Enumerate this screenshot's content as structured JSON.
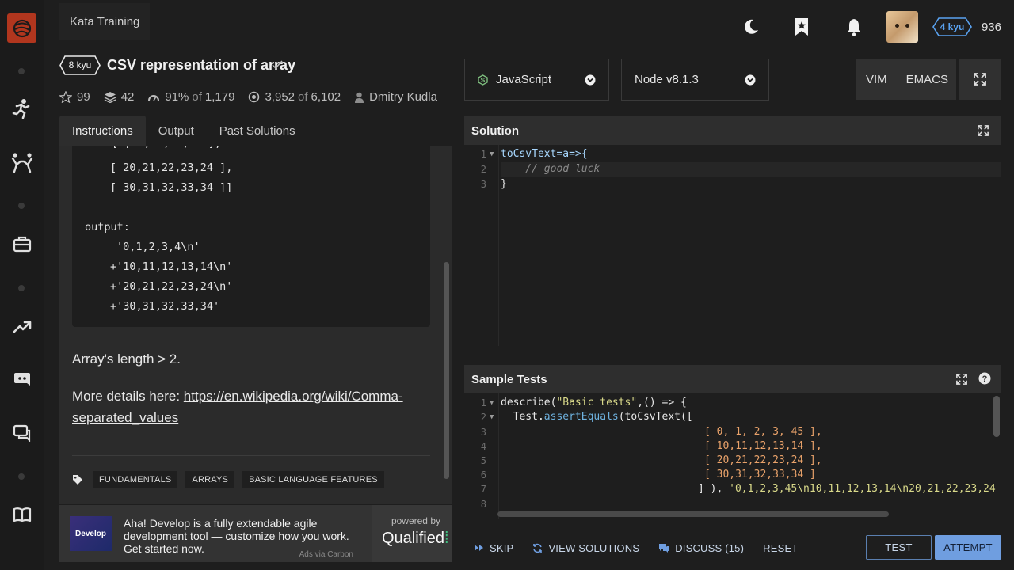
{
  "header": {
    "section_title": "Kata Training",
    "rank": "4 kyu",
    "honor": "936"
  },
  "kata": {
    "kyu": "8 kyu",
    "title": "CSV representation of array",
    "stats": {
      "stars": "99",
      "collections": "42",
      "satisfaction_pct": "91%",
      "satisfaction_of": "of",
      "satisfaction_total": "1,179",
      "completed": "3,952",
      "completed_of": "of",
      "completed_total": "6,102",
      "author": "Dmitry Kudla"
    }
  },
  "tabs": [
    {
      "label": "Instructions"
    },
    {
      "label": "Output"
    },
    {
      "label": "Past Solutions"
    }
  ],
  "instructions": {
    "code_lines": [
      "[ 20,21,22,23,24 ],",
      "[ 30,31,32,33,34 ]]",
      "output:",
      "'0,1,2,3,4\\n'",
      "+'10,11,12,13,14\\n'",
      "+'20,21,22,23,24\\n'",
      "+'30,31,32,33,34'"
    ],
    "para1": "Array's length > 2.",
    "para2_prefix": "More details here: ",
    "para2_link_line1": "https://en.wikipedia.org/wiki/Comma-",
    "para2_link_line2": "separated_values",
    "tags": [
      "FUNDAMENTALS",
      "ARRAYS",
      "BASIC LANGUAGE FEATURES"
    ]
  },
  "ad": {
    "logo_text": "Develop",
    "text": "Aha! Develop is a fully extendable agile development tool — customize how you work. Get started now.",
    "via": "Ads via Carbon",
    "powered_by": "powered by",
    "brand": "Qualified"
  },
  "editor": {
    "language": "JavaScript",
    "runtime": "Node v8.1.3",
    "modes": [
      "VIM",
      "EMACS"
    ],
    "solution_title": "Solution",
    "solution_lines": [
      {
        "n": "1",
        "text": "toCsvText=a=>{"
      },
      {
        "n": "2",
        "text": "    // good luck"
      },
      {
        "n": "3",
        "text": "}"
      }
    ],
    "tests_title": "Sample Tests",
    "test_line_numbers": [
      "1",
      "2",
      "3",
      "4",
      "5",
      "6",
      "7",
      "8"
    ],
    "test_lines": {
      "l1_a": "describe(",
      "l1_str": "\"Basic tests\"",
      "l1_b": ",() => {",
      "l2_a": "  Test.",
      "l2_method": "assertEquals",
      "l2_b": "(toCsvText([",
      "l3": "[ 0, 1, 2, 3, 45 ],",
      "l4": "[ 10,11,12,13,14 ],",
      "l5": "[ 20,21,22,23,24 ],",
      "l6": "[ 30,31,32,33,34 ]",
      "l7_a": "] ), ",
      "l7_str": "'0,1,2,3,45\\n10,11,12,13,14\\n20,21,22,23,24"
    }
  },
  "actions": {
    "skip": "SKIP",
    "view_solutions": "VIEW SOLUTIONS",
    "discuss": "DISCUSS (15)",
    "reset": "RESET",
    "test": "TEST",
    "attempt": "ATTEMPT"
  }
}
